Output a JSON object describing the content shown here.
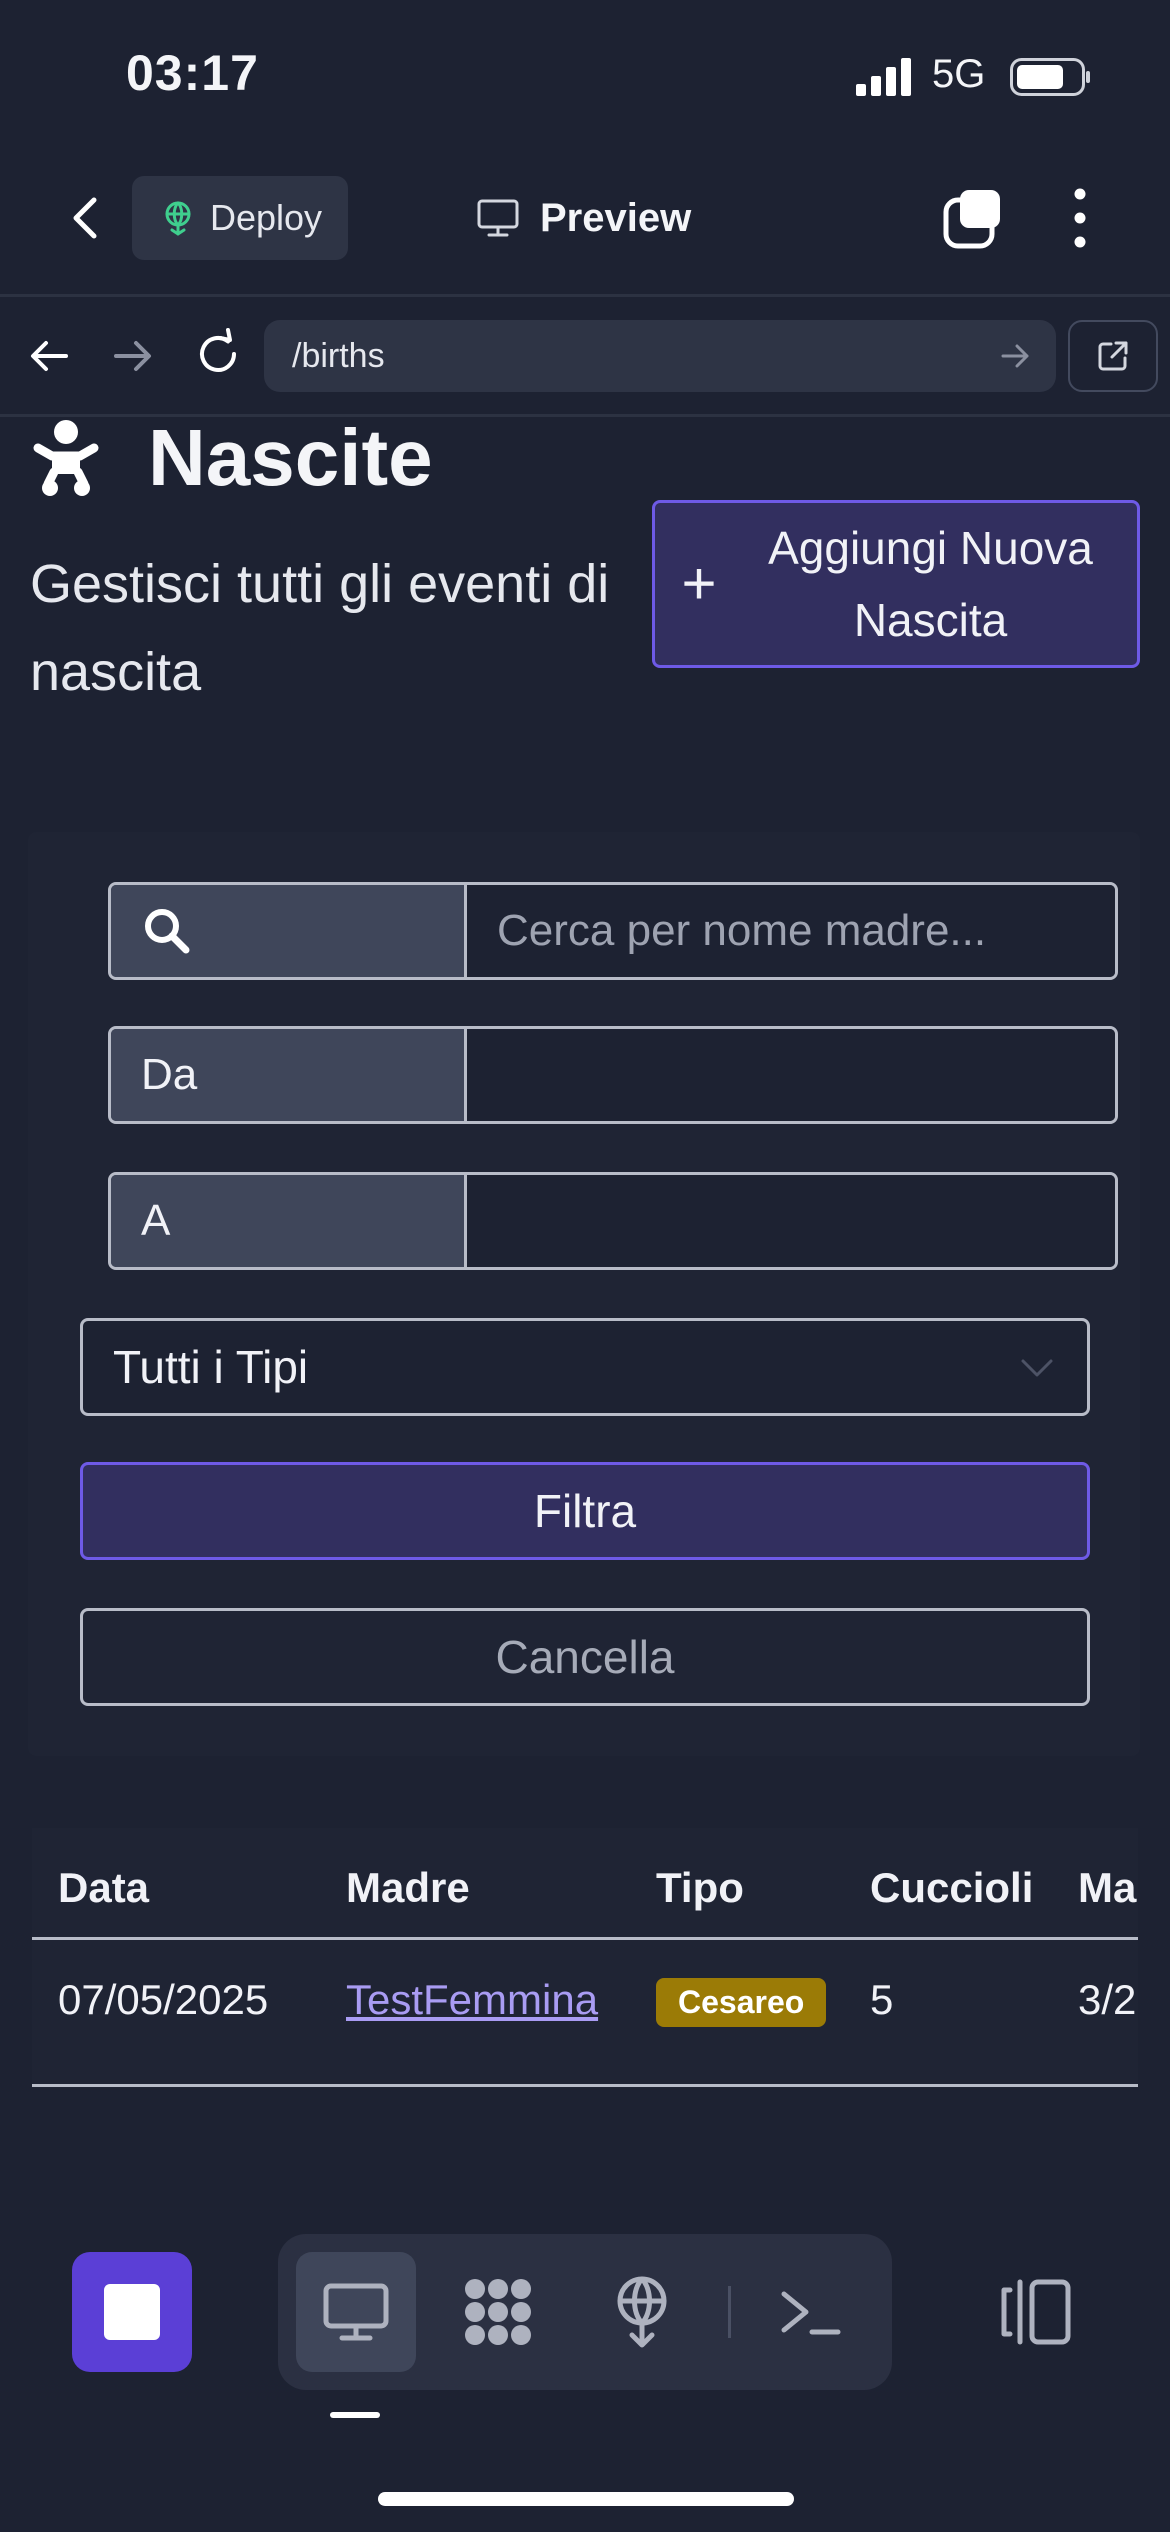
{
  "status_bar": {
    "time": "03:17",
    "network": "5G"
  },
  "app_bar": {
    "deploy_label": "Deploy",
    "preview_label": "Preview"
  },
  "browser": {
    "url": "/births"
  },
  "page": {
    "title": "Nascite",
    "subtitle": "Gestisci tutti gli eventi di nascita",
    "add_button": "Aggiungi Nuova Nascita"
  },
  "filters": {
    "search_placeholder": "Cerca per nome madre...",
    "from_label": "Da",
    "to_label": "A",
    "type_select": "Tutti i Tipi",
    "filter_button": "Filtra",
    "cancel_button": "Cancella"
  },
  "table": {
    "headers": [
      "Data",
      "Madre",
      "Tipo",
      "Cuccioli",
      "Ma"
    ],
    "rows": [
      {
        "date": "07/05/2025",
        "mother": "TestFemmina",
        "type": "Cesareo",
        "puppies": "5",
        "extra": "3/2"
      }
    ]
  },
  "colors": {
    "background": "#1d2232",
    "accent": "#6e5ae6",
    "stop": "#5b3fd6",
    "badge": "#9b7b06"
  },
  "icons": [
    "chevron-left-icon",
    "deploy-icon",
    "monitor-icon",
    "tabs-icon",
    "more-vertical-icon",
    "arrow-left-icon",
    "arrow-right-icon",
    "reload-icon",
    "external-link-icon",
    "baby-icon",
    "plus-icon",
    "search-icon",
    "chevron-down-icon",
    "stop-icon",
    "monitor-icon",
    "packages-icon",
    "deploy-icon",
    "terminal-icon",
    "panels-icon"
  ]
}
